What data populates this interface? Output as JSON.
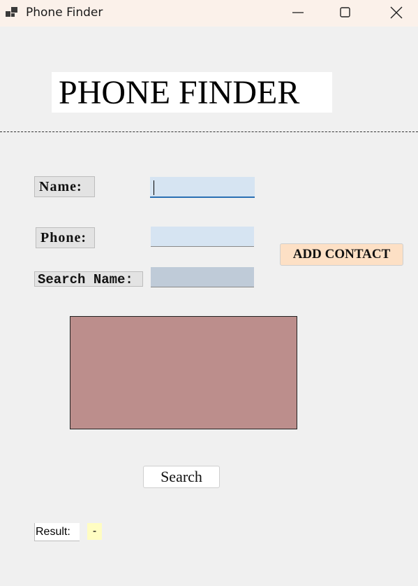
{
  "window": {
    "title": "Phone Finder",
    "app_icon": "app-window-icon",
    "controls": [
      "minimize-icon",
      "maximize-icon",
      "close-icon"
    ]
  },
  "heading": "PHONE FINDER",
  "form": {
    "name_label": "Name:",
    "name_value": "",
    "phone_label": "Phone:",
    "phone_value": "",
    "search_name_label": "Search Name:",
    "search_name_value": "",
    "add_contact_label": "ADD CONTACT"
  },
  "results_panel": {
    "items": []
  },
  "search_button_label": "Search",
  "result": {
    "label": "Result:",
    "value": "-"
  },
  "colors": {
    "titlebar": "#fbf1ea",
    "background": "#f0f0f0",
    "input_fill": "#d6e4f2",
    "search_input_fill": "#bfcbd8",
    "add_button": "#fde0c5",
    "results_panel": "#bc8e8c",
    "result_value": "#fffdc2",
    "focus_accent": "#2a6fb3"
  }
}
